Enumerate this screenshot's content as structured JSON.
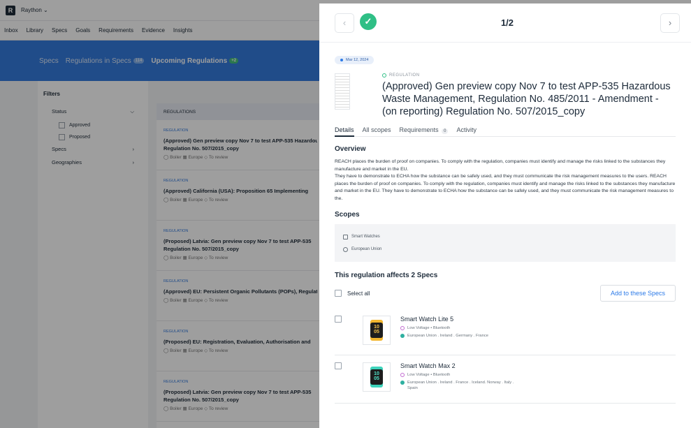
{
  "app": {
    "brand": "Raython",
    "logo": "R"
  },
  "nav": [
    "Inbox",
    "Library",
    "Specs",
    "Goals",
    "Requirements",
    "Evidence",
    "Insights"
  ],
  "banner": {
    "specs": "Specs",
    "regs": "Regulations in Specs",
    "regs_count": "114",
    "upcoming": "Upcoming Regulations",
    "upcoming_count": "+2"
  },
  "filters": {
    "title": "Filters",
    "status": "Status",
    "approved": "Approved",
    "proposed": "Proposed",
    "specs": "Specs",
    "geos": "Geographies"
  },
  "list": {
    "header": "REGULATIONS",
    "items": [
      {
        "kind": "REGULATION",
        "title1": "(Approved) Gen preview copy Nov 7 to test APP-535 Hazardous",
        "title2": "Regulation No. 507/2015_copy",
        "meta": "◯ Boiler  ▦ Europe  ◇ To review"
      },
      {
        "kind": "REGULATION",
        "title1": "(Approved) California (USA): Proposition 65 Implementing",
        "title2": "",
        "meta": "◯ Boiler  ▦ Europe  ◇ To review"
      },
      {
        "kind": "REGULATION",
        "title1": "(Proposed) Latvia: Gen preview copy Nov 7 to test APP-535",
        "title2": "Regulation No. 507/2015_copy",
        "meta": "◯ Boiler  ▦ Europe  ◇ To review"
      },
      {
        "kind": "REGULATION",
        "title1": "(Approved) EU: Persistent Organic Pollutants (POPs), Regulation",
        "title2": "",
        "meta": "◯ Boiler  ▦ Europe  ◇ To review"
      },
      {
        "kind": "REGULATION",
        "title1": "(Proposed) EU: Registration, Evaluation, Authorisation and",
        "title2": "",
        "meta": "◯ Boiler  ▦ Europe  ◇ To review"
      },
      {
        "kind": "REGULATION",
        "title1": "(Proposed) Latvia: Gen preview copy Nov 7 to test APP-535",
        "title2": "Regulation No. 507/2015_copy",
        "meta": "◯ Boiler  ▦ Europe  ◇ To review"
      }
    ]
  },
  "modal": {
    "counter": "1/2",
    "prev": "‹",
    "next": "›",
    "date": "Mar 12, 2024",
    "kind": "REGULATION",
    "title": "(Approved) Gen preview copy Nov 7 to test APP-535 Hazardous Waste Management, Regulation No. 485/2011 - Amendment - (on reporting) Regulation No. 507/2015_copy",
    "tabs": {
      "details": "Details",
      "scopes": "All scopes",
      "requirements": "Requirements",
      "req_count": "0",
      "activity": "Activity"
    },
    "overview_title": "Overview",
    "overview": "REACH places the burden of proof on companies. To comply with the regulation, companies must identify and manage the risks linked to the substances they manufacture and market in the EU.\nThey have to demonstrate to ECHA how the substance can be safely used, and they must communicate the risk management measures to the users. REACH places the burden of proof on companies. To comply with the regulation, companies must identify and manage the risks linked to the substances they manufacture and market in the EU. They have to demonstrate to ECHA how the substance can be safely used, and they must communicate the risk management measures to the.",
    "scopes_title": "Scopes",
    "scope_product": "Smart Watches",
    "scope_geo": "European Union",
    "affects": "This regulation affects 2 Specs",
    "select_all": "Select all",
    "add_btn": "Add to these Specs",
    "specs": [
      {
        "name": "Smart Watch Lite 5",
        "tech": "Low Voltage • Bluetooth",
        "geo": "European Union . Ireland . Germany . France",
        "face": "10\n05",
        "band": "#f2b630"
      },
      {
        "name": "Smart Watch Max 2",
        "tech": "Low Voltage • Bluetooth",
        "geo": "European Union . Ireland . France . Iceland. Norway . Italy .\nSpain",
        "face": "10\n05",
        "band": "#3ed3bb"
      }
    ]
  }
}
